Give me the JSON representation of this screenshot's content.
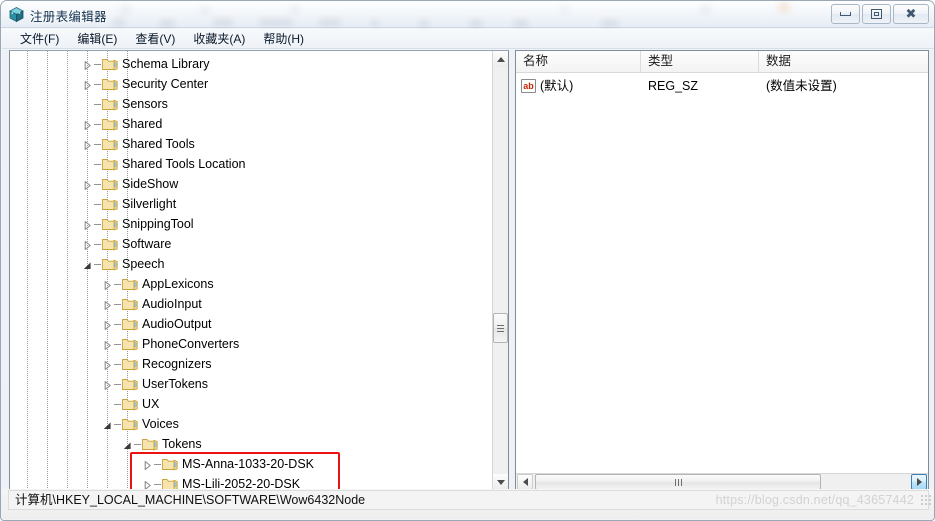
{
  "window": {
    "title": "注册表编辑器",
    "icon": "regedit-icon",
    "controls": {
      "minimize": "最小化",
      "maximize": "最大化",
      "close": "关闭"
    }
  },
  "menubar": {
    "items": [
      {
        "label": "文件(F)"
      },
      {
        "label": "编辑(E)"
      },
      {
        "label": "查看(V)"
      },
      {
        "label": "收藏夹(A)"
      },
      {
        "label": "帮助(H)"
      }
    ]
  },
  "tree": {
    "nodes": [
      {
        "label": "Schema Library",
        "depth": 4,
        "expander": "collapsed"
      },
      {
        "label": "Security Center",
        "depth": 4,
        "expander": "collapsed"
      },
      {
        "label": "Sensors",
        "depth": 4,
        "expander": "none"
      },
      {
        "label": "Shared",
        "depth": 4,
        "expander": "collapsed"
      },
      {
        "label": "Shared Tools",
        "depth": 4,
        "expander": "collapsed"
      },
      {
        "label": "Shared Tools Location",
        "depth": 4,
        "expander": "none"
      },
      {
        "label": "SideShow",
        "depth": 4,
        "expander": "collapsed"
      },
      {
        "label": "Silverlight",
        "depth": 4,
        "expander": "none"
      },
      {
        "label": "SnippingTool",
        "depth": 4,
        "expander": "collapsed"
      },
      {
        "label": "Software",
        "depth": 4,
        "expander": "collapsed"
      },
      {
        "label": "Speech",
        "depth": 4,
        "expander": "expanded"
      },
      {
        "label": "AppLexicons",
        "depth": 5,
        "expander": "collapsed"
      },
      {
        "label": "AudioInput",
        "depth": 5,
        "expander": "collapsed"
      },
      {
        "label": "AudioOutput",
        "depth": 5,
        "expander": "collapsed"
      },
      {
        "label": "PhoneConverters",
        "depth": 5,
        "expander": "collapsed"
      },
      {
        "label": "Recognizers",
        "depth": 5,
        "expander": "collapsed"
      },
      {
        "label": "UserTokens",
        "depth": 5,
        "expander": "collapsed"
      },
      {
        "label": "UX",
        "depth": 5,
        "expander": "none"
      },
      {
        "label": "Voices",
        "depth": 5,
        "expander": "expanded"
      },
      {
        "label": "Tokens",
        "depth": 6,
        "expander": "expanded"
      },
      {
        "label": "MS-Anna-1033-20-DSK",
        "depth": 7,
        "expander": "collapsed"
      },
      {
        "label": "MS-Lili-2052-20-DSK",
        "depth": 7,
        "expander": "collapsed"
      }
    ],
    "highlight": {
      "color": "#ee1111",
      "from_label": "MS-Anna-1033-20-DSK",
      "to_label": "MS-Lili-2052-20-DSK"
    }
  },
  "list": {
    "columns": [
      {
        "label": "名称"
      },
      {
        "label": "类型"
      },
      {
        "label": "数据"
      }
    ],
    "rows": [
      {
        "icon": "string-value-icon",
        "name": "(默认)",
        "type": "REG_SZ",
        "data": "(数值未设置)"
      }
    ]
  },
  "statusbar": {
    "path": "计算机\\HKEY_LOCAL_MACHINE\\SOFTWARE\\Wow6432Node",
    "watermark": "https://blog.csdn.net/qq_43657442"
  }
}
